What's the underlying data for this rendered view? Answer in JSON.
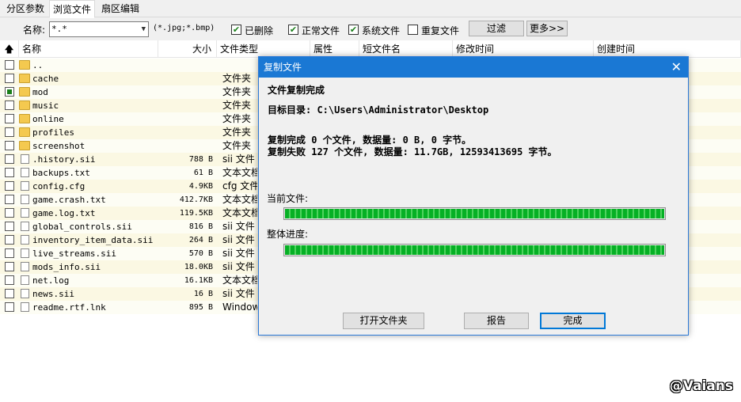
{
  "tabs": [
    {
      "label": "分区参数"
    },
    {
      "label": "浏览文件"
    },
    {
      "label": "扇区编辑"
    }
  ],
  "filter": {
    "name_label": "名称:",
    "name_value": "*.*",
    "name_hint": "(*.jpg;*.bmp)",
    "deleted_label": "已删除",
    "normal_label": "正常文件",
    "system_label": "系统文件",
    "duplicate_label": "重复文件",
    "filter_button": "过滤",
    "more_button": "更多>>"
  },
  "columns": {
    "up_icon": "up-arrow-icon",
    "name": "名称",
    "size": "大小",
    "type": "文件类型",
    "attr": "属性",
    "short_name": "短文件名",
    "modified": "修改时间",
    "created": "创建时间"
  },
  "rows": [
    {
      "name": "..",
      "size": "",
      "type": "",
      "icon": "folder",
      "checked": false
    },
    {
      "name": "cache",
      "size": "",
      "type": "文件夹",
      "icon": "folder",
      "checked": false
    },
    {
      "name": "mod",
      "size": "",
      "type": "文件夹",
      "icon": "folder",
      "checked": true
    },
    {
      "name": "music",
      "size": "",
      "type": "文件夹",
      "icon": "folder",
      "checked": false
    },
    {
      "name": "online",
      "size": "",
      "type": "文件夹",
      "icon": "folder",
      "checked": false
    },
    {
      "name": "profiles",
      "size": "",
      "type": "文件夹",
      "icon": "folder",
      "checked": false
    },
    {
      "name": "screenshot",
      "size": "",
      "type": "文件夹",
      "icon": "folder",
      "checked": false
    },
    {
      "name": ".history.sii",
      "size": "788 B",
      "type": "sii 文件",
      "icon": "file",
      "checked": false
    },
    {
      "name": "backups.txt",
      "size": "61 B",
      "type": "文本文档",
      "icon": "file",
      "checked": false
    },
    {
      "name": "config.cfg",
      "size": "4.9KB",
      "type": "cfg 文件",
      "icon": "file",
      "checked": false
    },
    {
      "name": "game.crash.txt",
      "size": "412.7KB",
      "type": "文本文档",
      "icon": "file",
      "checked": false
    },
    {
      "name": "game.log.txt",
      "size": "119.5KB",
      "type": "文本文档",
      "icon": "file",
      "checked": false
    },
    {
      "name": "global_controls.sii",
      "size": "816 B",
      "type": "sii 文件",
      "icon": "file",
      "checked": false
    },
    {
      "name": "inventory_item_data.sii",
      "size": "264 B",
      "type": "sii 文件",
      "icon": "file",
      "checked": false
    },
    {
      "name": "live_streams.sii",
      "size": "570 B",
      "type": "sii 文件",
      "icon": "file",
      "checked": false
    },
    {
      "name": "mods_info.sii",
      "size": "18.0KB",
      "type": "sii 文件",
      "icon": "file",
      "checked": false
    },
    {
      "name": "net.log",
      "size": "16.1KB",
      "type": "文本文档",
      "icon": "file",
      "checked": false
    },
    {
      "name": "news.sii",
      "size": "16 B",
      "type": "sii 文件",
      "icon": "file",
      "checked": false
    },
    {
      "name": "readme.rtf.lnk",
      "size": "895 B",
      "type": "Windows",
      "icon": "file",
      "checked": false
    }
  ],
  "dialog": {
    "title": "复制文件",
    "heading": "文件复制完成",
    "target_dir": "目标目录: C:\\Users\\Administrator\\Desktop",
    "success_line": "复制完成 0 个文件, 数据量: 0 B, 0 字节。",
    "fail_line": "复制失败 127 个文件, 数据量: 11.7GB, 12593413695 字节。",
    "current_file_label": "当前文件:",
    "overall_label": "整体进度:",
    "current_progress": 1.0,
    "overall_progress": 1.0,
    "open_folder_button": "打开文件夹",
    "report_button": "报告",
    "done_button": "完成"
  },
  "watermark": "@Vaians",
  "colors": {
    "accent": "#1a78d4",
    "progress": "#06b025"
  }
}
